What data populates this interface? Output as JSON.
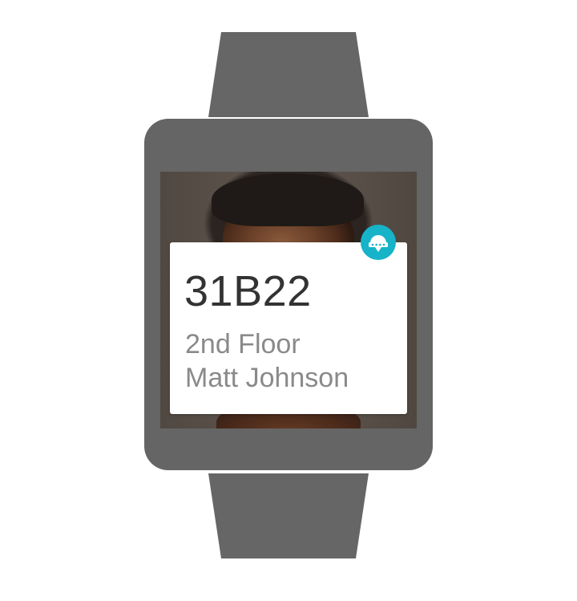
{
  "card": {
    "title": "31B22",
    "line1": "2nd Floor",
    "line2": "Matt Johnson"
  },
  "app_icon": {
    "name": "conference-room-icon",
    "color": "#17b3c9"
  },
  "device": {
    "body_color": "#656565",
    "strap_color": "#666666"
  }
}
